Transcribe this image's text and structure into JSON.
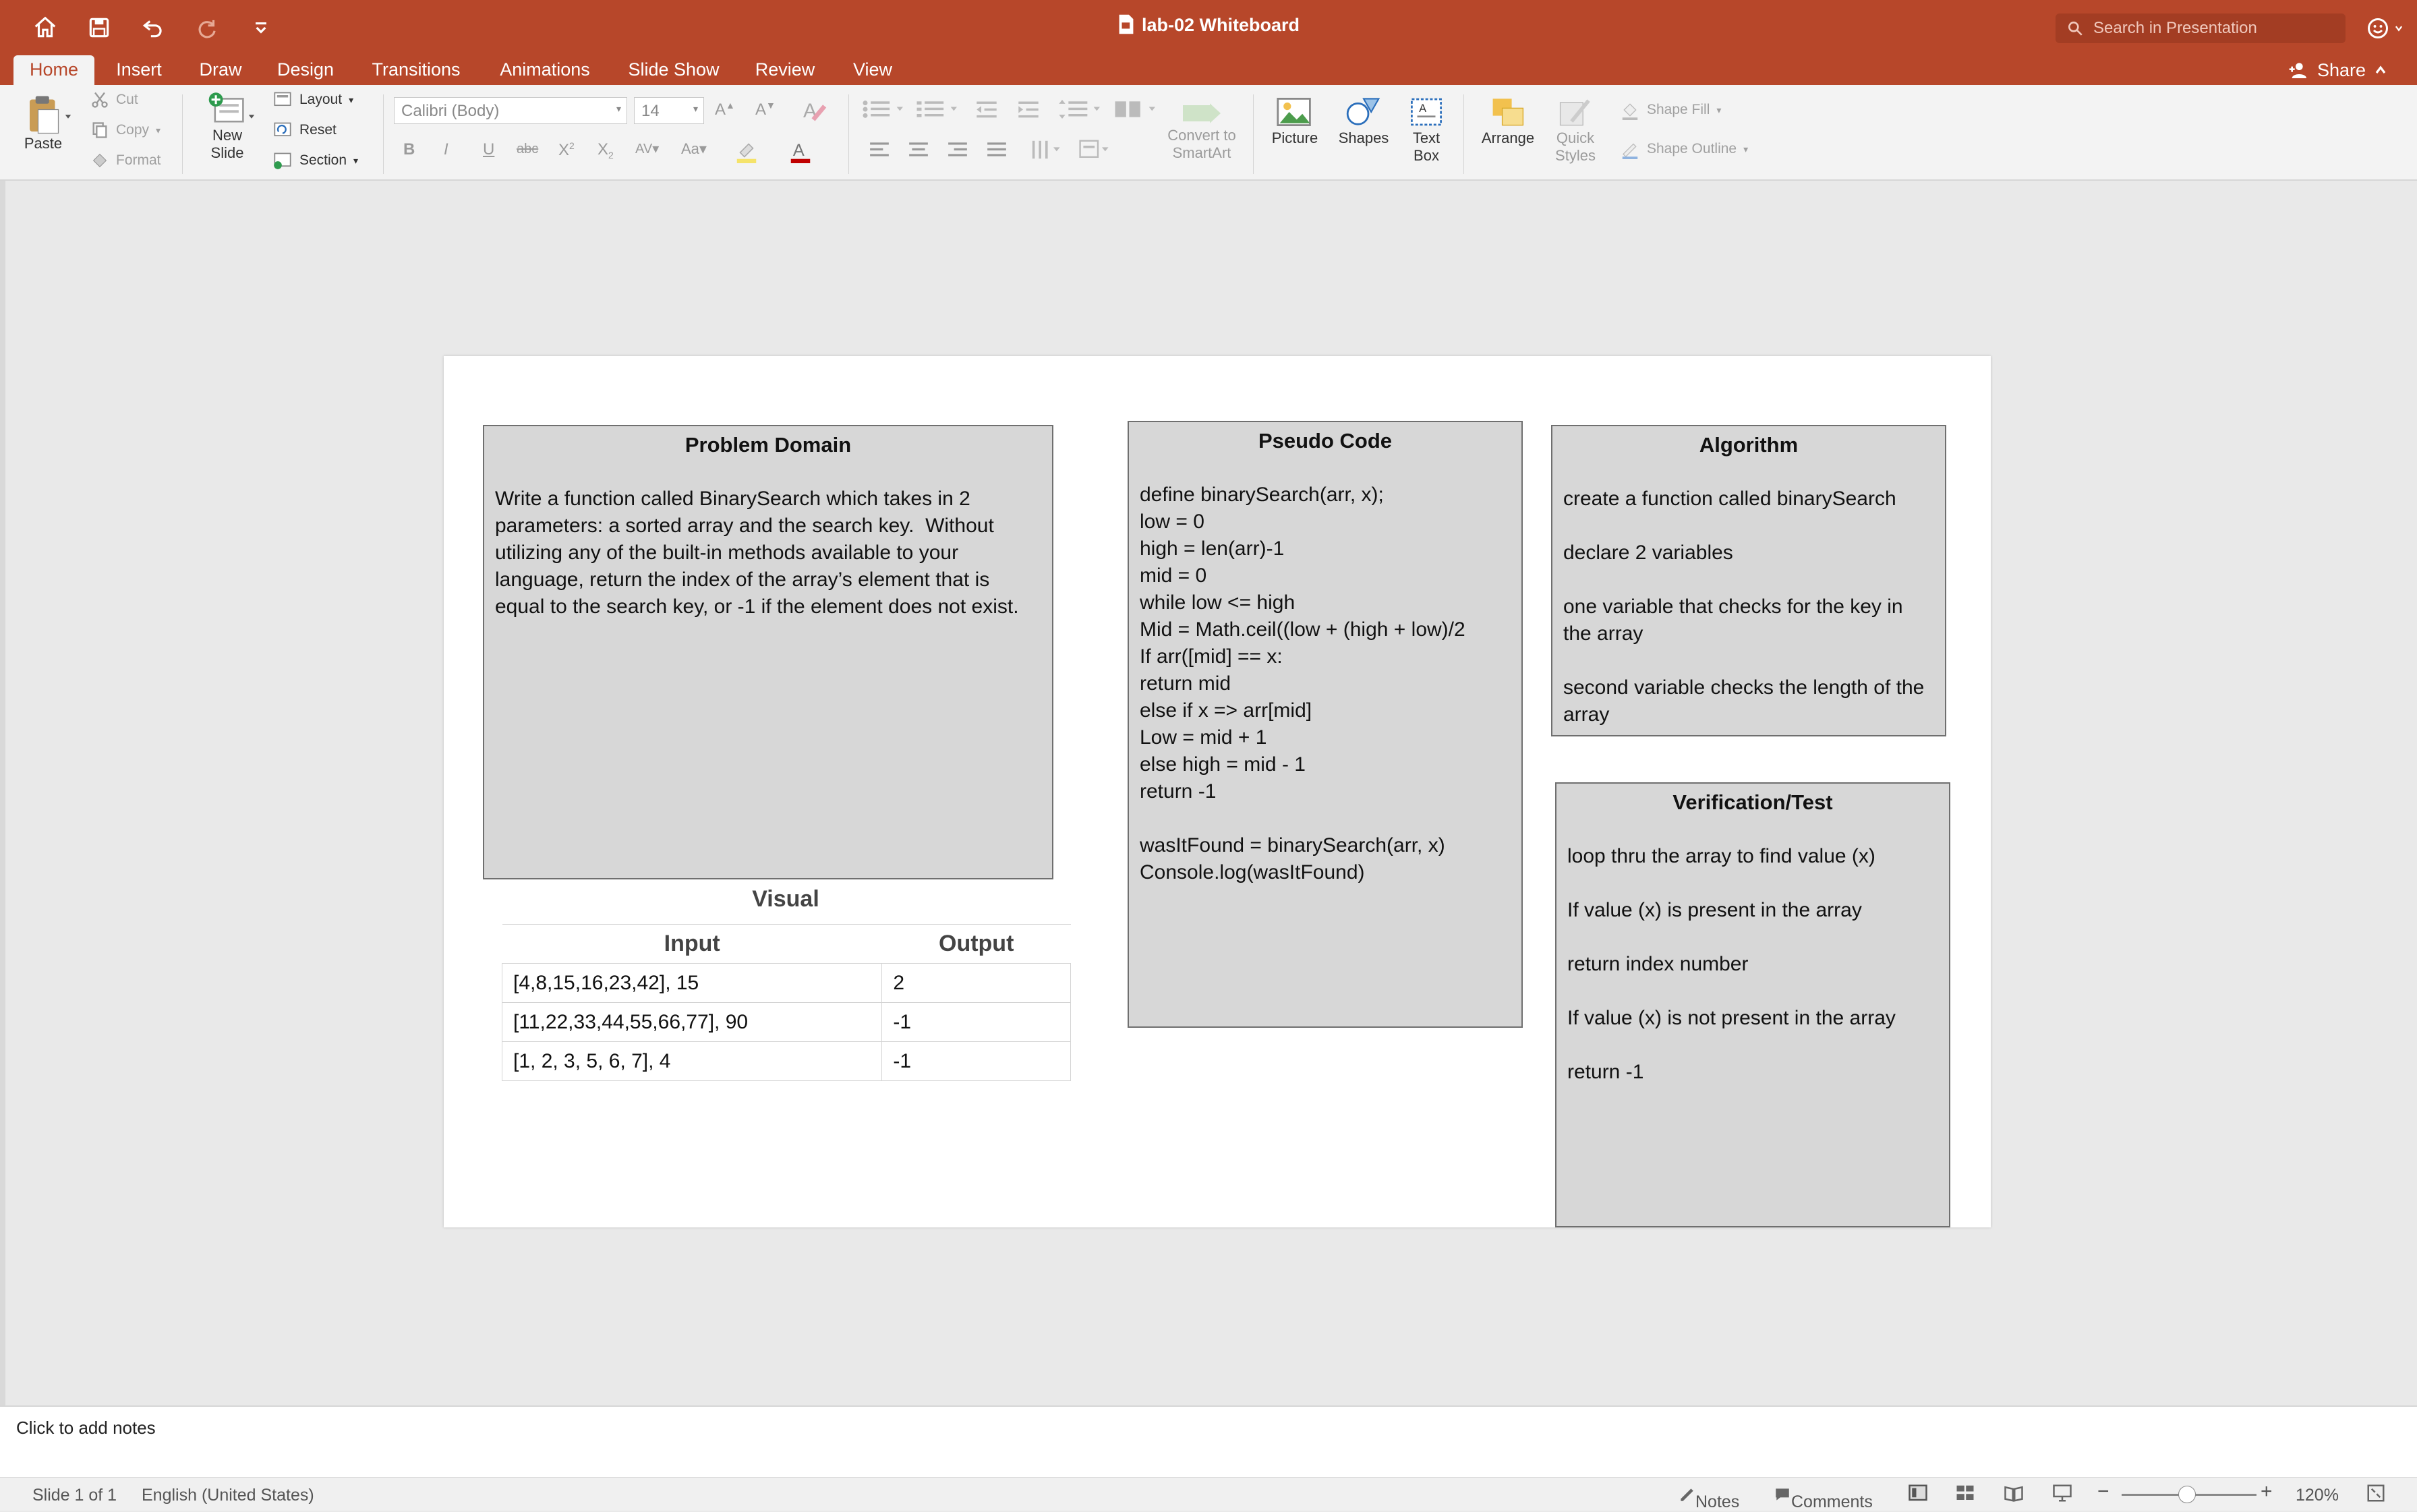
{
  "window": {
    "title": "lab-02 Whiteboard",
    "search_placeholder": "Search in Presentation",
    "share_label": "Share"
  },
  "tabs": [
    "Home",
    "Insert",
    "Draw",
    "Design",
    "Transitions",
    "Animations",
    "Slide Show",
    "Review",
    "View"
  ],
  "active_tab": "Home",
  "ribbon": {
    "paste": "Paste",
    "cut": "Cut",
    "copy": "Copy",
    "format": "Format",
    "new_slide_1": "New",
    "new_slide_2": "Slide",
    "layout": "Layout",
    "reset": "Reset",
    "section": "Section",
    "font_name": "Calibri (Body)",
    "font_size": "14",
    "convert_1": "Convert to",
    "convert_2": "SmartArt",
    "picture": "Picture",
    "shapes": "Shapes",
    "textbox_1": "Text",
    "textbox_2": "Box",
    "arrange": "Arrange",
    "quick_styles_1": "Quick",
    "quick_styles_2": "Styles",
    "shape_fill": "Shape Fill",
    "shape_outline": "Shape Outline"
  },
  "slide": {
    "problem_domain": {
      "title": "Problem Domain",
      "body": "Write a function called BinarySearch which takes in 2 parameters: a sorted array and the search key.  Without utilizing any of the built-in methods available to your language, return the index of the array’s element that is equal to the search key, or -1 if the element does not exist."
    },
    "pseudo_code": {
      "title": "Pseudo Code",
      "lines": [
        "define binarySearch(arr, x);",
        "low = 0",
        "high = len(arr)-1",
        "mid = 0",
        "while low <= high",
        "Mid = Math.ceil((low + (high + low)/2",
        "If arr([mid] == x:",
        "return mid",
        "else if x => arr[mid]",
        "Low = mid + 1",
        "else high = mid - 1",
        "return -1",
        "",
        "wasItFound = binarySearch(arr, x)",
        "Console.log(wasItFound)"
      ]
    },
    "algorithm": {
      "title": "Algorithm",
      "lines": [
        "create a function called binarySearch",
        "",
        "declare 2 variables",
        "",
        "one variable that checks for the key in the array",
        "",
        "second variable checks the length of the array"
      ]
    },
    "verification": {
      "title": "Verification/Test",
      "lines": [
        "loop thru the array to find value (x)",
        "",
        "If value (x) is present in the array",
        "",
        "return index number",
        "",
        "If value (x) is not present in the array",
        "",
        "return -1"
      ]
    },
    "visual": {
      "title": "Visual",
      "headers": [
        "Input",
        "Output"
      ],
      "rows": [
        [
          "[4,8,15,16,23,42], 15",
          "2"
        ],
        [
          "[11,22,33,44,55,66,77], 90",
          "-1"
        ],
        [
          "[1, 2, 3, 5, 6, 7], 4",
          "-1"
        ]
      ]
    }
  },
  "notes_placeholder": "Click to add notes",
  "status": {
    "slide_count": "Slide 1 of 1",
    "language": "English (United States)",
    "notes": "Notes",
    "comments": "Comments",
    "zoom": "120%"
  },
  "colors": {
    "accent": "#b7472a",
    "box_fill": "#d7d7d7"
  }
}
